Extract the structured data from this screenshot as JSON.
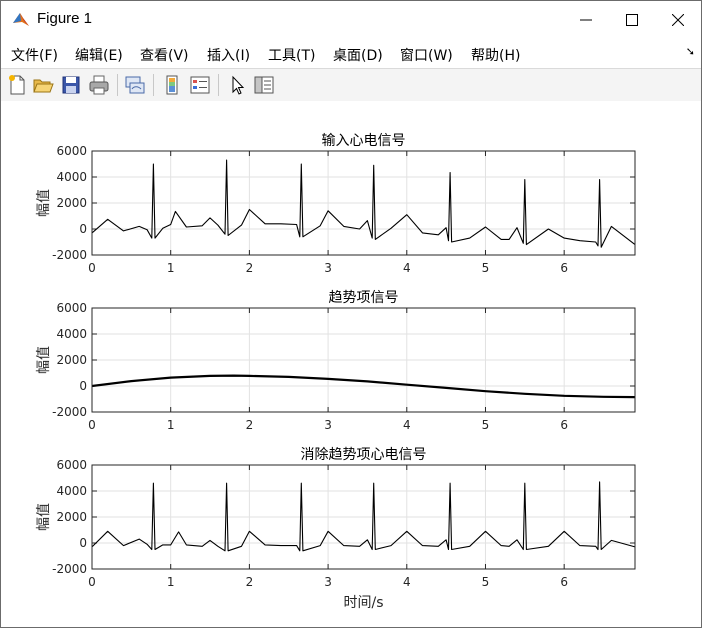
{
  "window": {
    "title": "Figure 1",
    "controls": [
      "minimize",
      "maximize",
      "close"
    ]
  },
  "menubar": {
    "items": [
      "文件(F)",
      "编辑(E)",
      "查看(V)",
      "插入(I)",
      "工具(T)",
      "桌面(D)",
      "窗口(W)",
      "帮助(H)"
    ]
  },
  "toolbar": {
    "icons": [
      "new-figure-icon",
      "open-file-icon",
      "save-icon",
      "print-icon",
      "link-plot-icon",
      "colorbar-icon",
      "legend-icon",
      "pointer-icon",
      "property-inspector-icon"
    ]
  },
  "colors": {
    "line": "#000000",
    "grid": "#e2e2e2",
    "axes": "#262626"
  },
  "chart_data": [
    {
      "type": "line",
      "title": "输入心电信号",
      "xlabel": "",
      "ylabel": "幅值",
      "xlim": [
        0,
        6.9
      ],
      "ylim": [
        -2000,
        6000
      ],
      "xticks": [
        "0",
        "1",
        "2",
        "3",
        "4",
        "5",
        "6"
      ],
      "yticks": [
        "-2000",
        "0",
        "2000",
        "4000",
        "6000"
      ],
      "grid": true,
      "series": [
        {
          "x": [
            0,
            0.2,
            0.4,
            0.6,
            0.7,
            0.76,
            0.78,
            0.8,
            0.9,
            1.0,
            1.06,
            1.2,
            1.4,
            1.5,
            1.6,
            1.69,
            1.71,
            1.73,
            1.9,
            2.0,
            2.2,
            2.4,
            2.6,
            2.64,
            2.66,
            2.68,
            2.9,
            3.0,
            3.2,
            3.4,
            3.5,
            3.56,
            3.58,
            3.6,
            3.8,
            4.0,
            4.2,
            4.4,
            4.5,
            4.53,
            4.55,
            4.57,
            4.8,
            5.0,
            5.2,
            5.3,
            5.4,
            5.48,
            5.5,
            5.52,
            5.8,
            6.0,
            6.2,
            6.4,
            6.43,
            6.45,
            6.47,
            6.6,
            6.9
          ],
          "y": [
            -300,
            750,
            -150,
            200,
            -50,
            -700,
            5000,
            -700,
            50,
            350,
            1350,
            150,
            250,
            850,
            300,
            -400,
            5300,
            -500,
            300,
            1500,
            400,
            400,
            350,
            -600,
            5000,
            -600,
            250,
            1400,
            200,
            0,
            650,
            -700,
            4900,
            -800,
            50,
            1100,
            -300,
            -450,
            100,
            -900,
            4350,
            -1000,
            -700,
            150,
            -800,
            -800,
            100,
            -1100,
            3800,
            -1200,
            0,
            -700,
            -900,
            -1000,
            -1300,
            3800,
            -1400,
            200,
            -1200
          ]
        }
      ]
    },
    {
      "type": "line",
      "title": "趋势项信号",
      "xlabel": "",
      "ylabel": "幅值",
      "xlim": [
        0,
        6.9
      ],
      "ylim": [
        -2000,
        6000
      ],
      "xticks": [
        "0",
        "1",
        "2",
        "3",
        "4",
        "5",
        "6"
      ],
      "yticks": [
        "-2000",
        "0",
        "2000",
        "4000",
        "6000"
      ],
      "grid": true,
      "series": [
        {
          "x": [
            0,
            0.5,
            1.0,
            1.5,
            1.8,
            2.0,
            2.5,
            3.0,
            3.5,
            4.0,
            4.5,
            5.0,
            5.5,
            6.0,
            6.5,
            6.9
          ],
          "y": [
            0,
            380,
            650,
            780,
            800,
            780,
            700,
            550,
            350,
            100,
            -150,
            -400,
            -600,
            -750,
            -830,
            -850
          ]
        }
      ]
    },
    {
      "type": "line",
      "title": "消除趋势项心电信号",
      "xlabel": "时间/s",
      "ylabel": "幅值",
      "xlim": [
        0,
        6.9
      ],
      "ylim": [
        -2000,
        6000
      ],
      "xticks": [
        "0",
        "1",
        "2",
        "3",
        "4",
        "5",
        "6"
      ],
      "yticks": [
        "-2000",
        "0",
        "2000",
        "4000",
        "6000"
      ],
      "grid": true,
      "series": [
        {
          "x": [
            0,
            0.2,
            0.4,
            0.6,
            0.7,
            0.76,
            0.78,
            0.8,
            0.9,
            1.0,
            1.1,
            1.2,
            1.4,
            1.5,
            1.6,
            1.69,
            1.71,
            1.73,
            1.9,
            2.0,
            2.2,
            2.4,
            2.6,
            2.64,
            2.66,
            2.68,
            2.9,
            3.0,
            3.2,
            3.4,
            3.5,
            3.56,
            3.58,
            3.6,
            3.8,
            4.0,
            4.2,
            4.4,
            4.5,
            4.53,
            4.55,
            4.57,
            4.8,
            5.0,
            5.2,
            5.3,
            5.4,
            5.48,
            5.5,
            5.52,
            5.8,
            6.0,
            6.2,
            6.4,
            6.43,
            6.45,
            6.47,
            6.6,
            6.9
          ],
          "y": [
            -300,
            900,
            -200,
            300,
            -100,
            -500,
            4600,
            -500,
            -150,
            -150,
            850,
            -150,
            -250,
            200,
            -250,
            -600,
            4600,
            -600,
            -250,
            900,
            -150,
            -200,
            -200,
            -600,
            4600,
            -600,
            -200,
            900,
            -200,
            -250,
            250,
            -500,
            4600,
            -500,
            -200,
            900,
            -200,
            -250,
            250,
            -500,
            4600,
            -500,
            -250,
            900,
            -200,
            -250,
            250,
            -500,
            4600,
            -500,
            -250,
            900,
            -200,
            -250,
            -500,
            4700,
            -500,
            200,
            -300
          ]
        }
      ]
    }
  ]
}
